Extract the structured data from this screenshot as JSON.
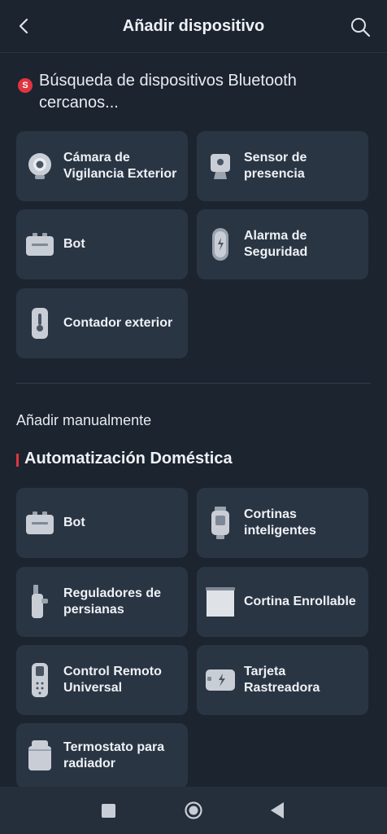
{
  "header": {
    "title": "Añadir dispositivo",
    "back_icon": "chevron-left-icon",
    "search_icon": "search-icon"
  },
  "scan": {
    "badge": "S",
    "text": "Búsqueda de dispositivos Bluetooth cercanos..."
  },
  "nearby_devices": [
    {
      "label_line1": "Cámara de",
      "label_line2": "Vigilancia Exterior",
      "icon": "outdoor-camera-icon"
    },
    {
      "label_line1": "Sensor de",
      "label_line2": "presencia",
      "icon": "presence-sensor-icon"
    },
    {
      "label_line1": "Bot",
      "label_line2": "",
      "icon": "bot-icon"
    },
    {
      "label_line1": "Alarma de",
      "label_line2": "Seguridad",
      "icon": "security-alarm-icon"
    },
    {
      "label_line1": "Contador exterior",
      "label_line2": "",
      "icon": "outdoor-meter-icon"
    }
  ],
  "manual": {
    "title": "Añadir manualmente",
    "category": "Automatización Doméstica",
    "accent_color": "#e0353f",
    "devices": [
      {
        "label_line1": "Bot",
        "label_line2": "",
        "icon": "bot-icon"
      },
      {
        "label_line1": "Cortinas",
        "label_line2": "inteligentes",
        "icon": "smart-curtain-icon"
      },
      {
        "label_line1": "Reguladores de",
        "label_line2": "persianas",
        "icon": "blind-tilt-icon"
      },
      {
        "label_line1": "Cortina Enrollable",
        "label_line2": "",
        "icon": "roller-shade-icon"
      },
      {
        "label_line1": "Control Remoto",
        "label_line2": "Universal",
        "icon": "universal-remote-icon"
      },
      {
        "label_line1": "Tarjeta",
        "label_line2": "Rastreadora",
        "icon": "tracker-card-icon"
      },
      {
        "label_line1": "Termostato para",
        "label_line2": "radiador",
        "icon": "radiator-thermostat-icon"
      }
    ]
  },
  "navbar": {
    "recents_icon": "square-icon",
    "home_icon": "home-circle-icon",
    "back_icon": "triangle-back-icon"
  }
}
